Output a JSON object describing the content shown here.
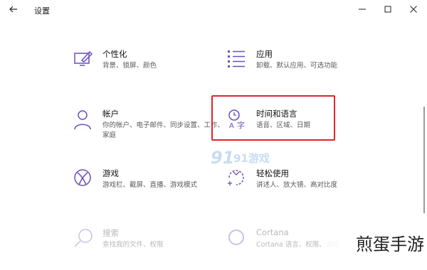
{
  "window": {
    "title": "设置",
    "icons": {
      "back": "back-arrow-icon",
      "minimize": "minimize-icon",
      "maximize": "maximize-icon",
      "close": "close-icon"
    }
  },
  "tiles": [
    {
      "key": "personalization",
      "name": "个性化",
      "desc": "背景、锁屏、颜色",
      "icon": "personalization-icon"
    },
    {
      "key": "apps",
      "name": "应用",
      "desc": "卸载、默认应用、可选功能",
      "icon": "apps-icon"
    },
    {
      "key": "accounts",
      "name": "帐户",
      "desc": "你的帐户、电子邮件、同步设置、工作、家庭",
      "icon": "account-icon"
    },
    {
      "key": "time-language",
      "name": "时间和语言",
      "desc": "语音、区域、日期",
      "icon": "time-language-icon"
    },
    {
      "key": "gaming",
      "name": "游戏",
      "desc": "游戏栏、截屏、直播、游戏模式",
      "icon": "xbox-icon"
    },
    {
      "key": "ease-of-access",
      "name": "轻松使用",
      "desc": "讲述人、放大镜、高对比度",
      "icon": "ease-of-access-icon"
    },
    {
      "key": "search",
      "name": "搜索",
      "desc": "查找我的文件、权限",
      "icon": "search-icon"
    },
    {
      "key": "cortana",
      "name": "Cortana",
      "desc": "Cortana 语言、权限、通知",
      "icon": "cortana-icon"
    }
  ],
  "watermark": {
    "center": "91游戏",
    "corner": "煎蛋手游"
  },
  "colors": {
    "accent": "#6b4fbb",
    "highlight": "#e0242a"
  }
}
